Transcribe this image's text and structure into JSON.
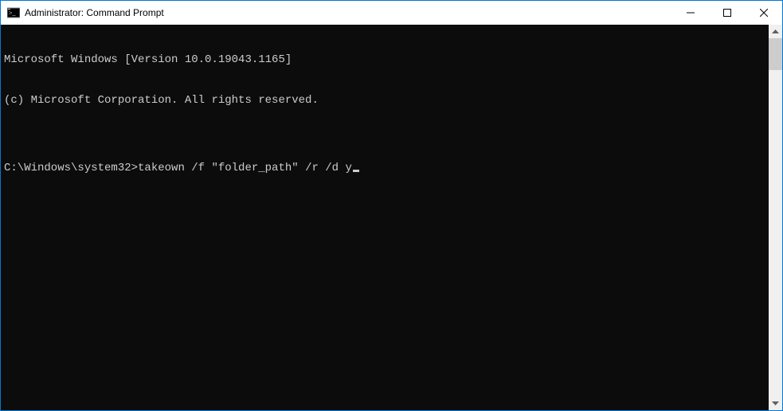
{
  "window": {
    "title": "Administrator: Command Prompt"
  },
  "terminal": {
    "line1": "Microsoft Windows [Version 10.0.19043.1165]",
    "line2": "(c) Microsoft Corporation. All rights reserved.",
    "blank": "",
    "prompt": "C:\\Windows\\system32>",
    "command": "takeown /f \"folder_path\" /r /d y"
  }
}
